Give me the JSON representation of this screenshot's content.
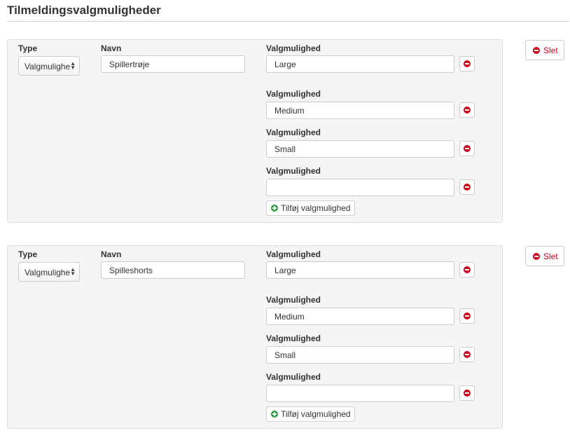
{
  "page": {
    "title": "Tilmeldingsvalgmuligheder"
  },
  "colors": {
    "danger": "#d0021b",
    "success": "#2a9d3a",
    "panel": "#f5f5f5",
    "border": "#cccccc"
  },
  "groups": [
    {
      "type_label": "Type",
      "type_value": "Valgmulighe",
      "name_label": "Navn",
      "name_value": "Spillertrøje",
      "choices": [
        {
          "label": "Valgmulighed",
          "value": "Large"
        },
        {
          "label": "Valgmulighed",
          "value": "Medium"
        },
        {
          "label": "Valgmulighed",
          "value": "Small"
        },
        {
          "label": "Valgmulighed",
          "value": ""
        }
      ],
      "add_label": "Tilføj valgmulighed",
      "delete_label": "Slet"
    },
    {
      "type_label": "Type",
      "type_value": "Valgmulighe",
      "name_label": "Navn",
      "name_value": "Spilleshorts",
      "choices": [
        {
          "label": "Valgmulighed",
          "value": "Large"
        },
        {
          "label": "Valgmulighed",
          "value": "Medium"
        },
        {
          "label": "Valgmulighed",
          "value": "Small"
        },
        {
          "label": "Valgmulighed",
          "value": ""
        }
      ],
      "add_label": "Tilføj valgmulighed",
      "delete_label": "Slet"
    }
  ]
}
